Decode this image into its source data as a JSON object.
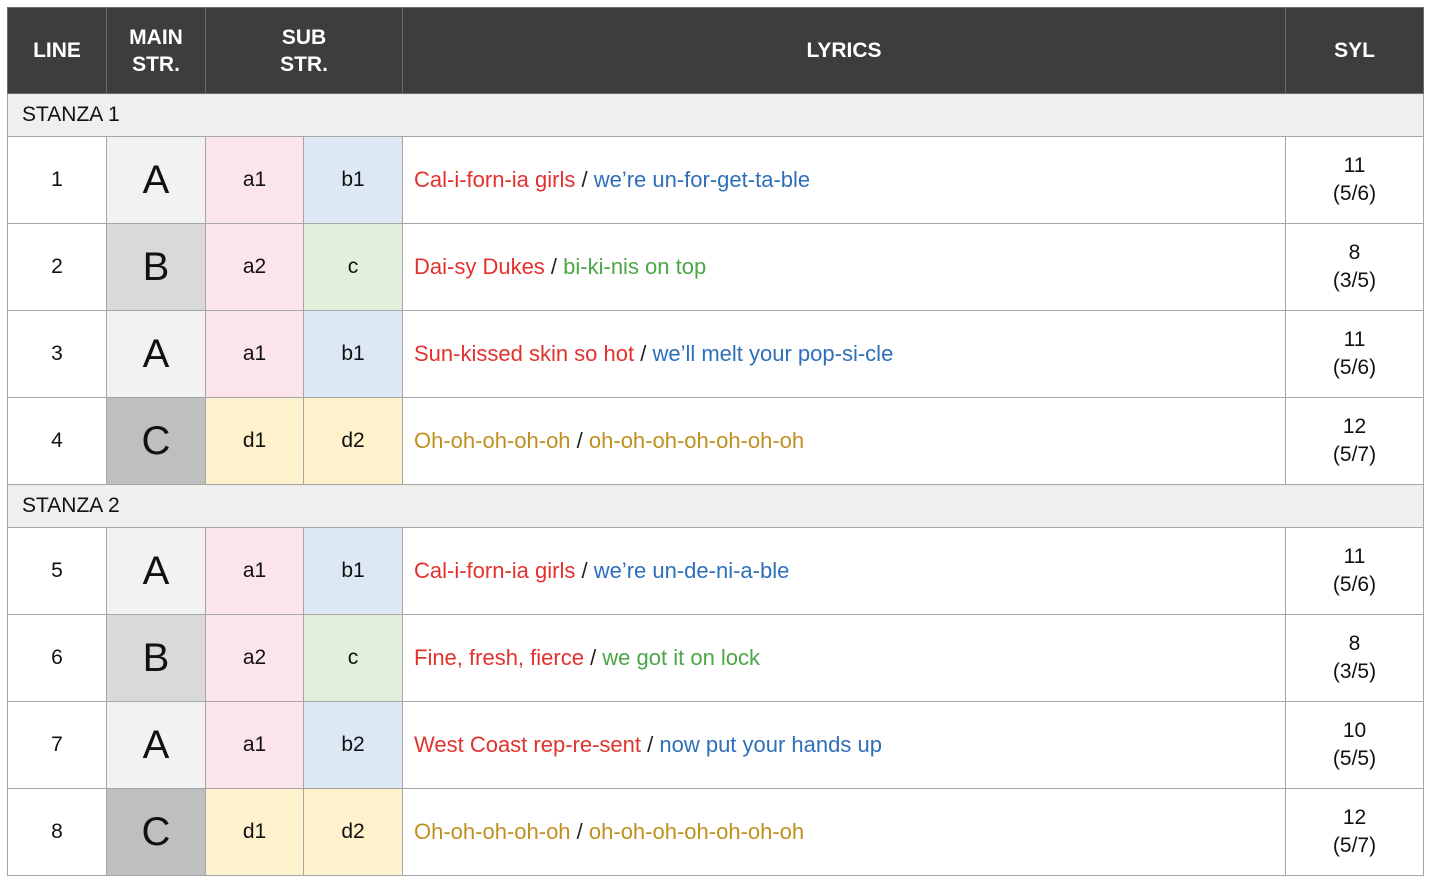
{
  "header": {
    "line": "LINE",
    "main_str": "MAIN STR.",
    "sub_str": "SUB STR.",
    "lyrics": "LYRICS",
    "syl": "SYL"
  },
  "colors": {
    "header_bg": "#3d3d3d",
    "stanza_bg": "#efefef",
    "main_A": "#f2f2f2",
    "main_B": "#d9d9d9",
    "main_C": "#bfbfbf",
    "sub_pink": "#fbe4ea",
    "sub_blue": "#dde8f5",
    "sub_green": "#e2efda",
    "sub_yellow": "#fdf2cc",
    "text_red": "#e2322e",
    "text_blue": "#2f6fba",
    "text_green": "#4ca647",
    "text_gold": "#bf9020"
  },
  "stanzas": [
    {
      "label": "STANZA 1",
      "rows": [
        {
          "line": "1",
          "main": "A",
          "sub1": "a1",
          "sub2": "b1",
          "part1": "Cal-i-forn-ia girls",
          "part2": "we’re un-for-get-ta-ble",
          "syl_total": "11",
          "syl_split": "(5/6)"
        },
        {
          "line": "2",
          "main": "B",
          "sub1": "a2",
          "sub2": "c",
          "part1": "Dai-sy Dukes",
          "part2": "bi-ki-nis on top",
          "syl_total": "8",
          "syl_split": "(3/5)"
        },
        {
          "line": "3",
          "main": "A",
          "sub1": "a1",
          "sub2": "b1",
          "part1": "Sun-kissed skin so hot",
          "part2": "we’ll melt your pop-si-cle",
          "syl_total": "11",
          "syl_split": "(5/6)"
        },
        {
          "line": "4",
          "main": "C",
          "sub1": "d1",
          "sub2": "d2",
          "part1": "Oh-oh-oh-oh-oh",
          "part2": "oh-oh-oh-oh-oh-oh-oh",
          "syl_total": "12",
          "syl_split": "(5/7)"
        }
      ]
    },
    {
      "label": "STANZA 2",
      "rows": [
        {
          "line": "5",
          "main": "A",
          "sub1": "a1",
          "sub2": "b1",
          "part1": "Cal-i-forn-ia girls",
          "part2": "we’re un-de-ni-a-ble",
          "syl_total": "11",
          "syl_split": "(5/6)"
        },
        {
          "line": "6",
          "main": "B",
          "sub1": "a2",
          "sub2": "c",
          "part1": "Fine, fresh, fierce",
          "part2": "we got it on lock",
          "syl_total": "8",
          "syl_split": "(3/5)"
        },
        {
          "line": "7",
          "main": "A",
          "sub1": "a1",
          "sub2": "b2",
          "part1": "West Coast rep-re-sent",
          "part2": "now put your hands up",
          "syl_total": "10",
          "syl_split": "(5/5)"
        },
        {
          "line": "8",
          "main": "C",
          "sub1": "d1",
          "sub2": "d2",
          "part1": "Oh-oh-oh-oh-oh",
          "part2": "oh-oh-oh-oh-oh-oh-oh",
          "syl_total": "12",
          "syl_split": "(5/7)"
        }
      ]
    }
  ]
}
